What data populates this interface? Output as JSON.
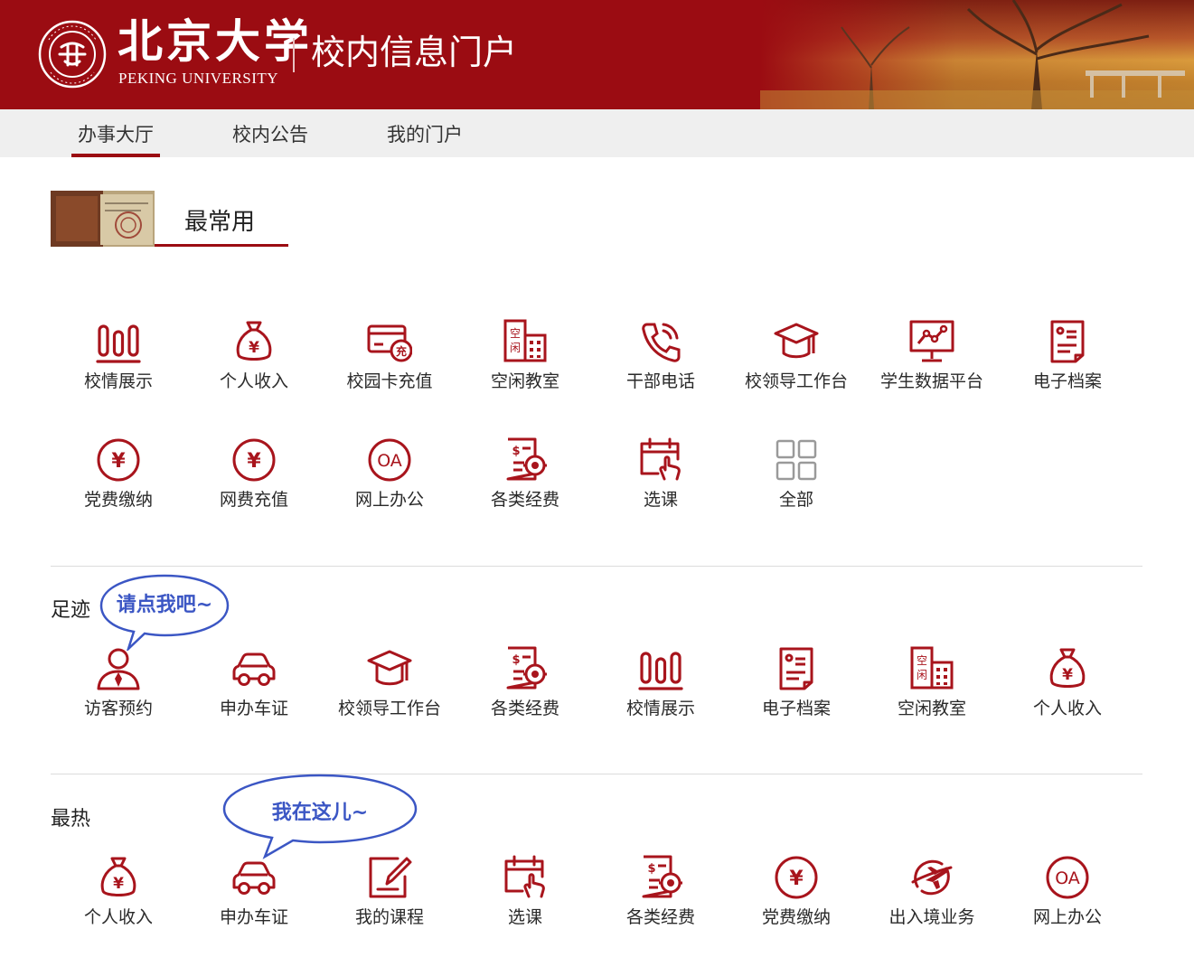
{
  "header": {
    "logo_cn": "北京大学",
    "logo_en": "PEKING UNIVERSITY",
    "portal_title": "校内信息门户",
    "brand_color": "#9b0c12"
  },
  "nav": {
    "tabs": [
      {
        "label": "办事大厅",
        "active": true
      },
      {
        "label": "校内公告",
        "active": false
      },
      {
        "label": "我的门户",
        "active": false
      }
    ]
  },
  "most_used": {
    "title": "最常用",
    "row1": [
      {
        "label": "校情展示",
        "icon": "bar-chart-icon"
      },
      {
        "label": "个人收入",
        "icon": "money-bag-icon"
      },
      {
        "label": "校园卡充值",
        "icon": "card-recharge-icon"
      },
      {
        "label": "空闲教室",
        "icon": "building-icon"
      },
      {
        "label": "干部电话",
        "icon": "phone-icon"
      },
      {
        "label": "校领导工作台",
        "icon": "graduation-cap-icon"
      },
      {
        "label": "学生数据平台",
        "icon": "monitor-chart-icon"
      },
      {
        "label": "电子档案",
        "icon": "document-icon"
      }
    ],
    "row2": [
      {
        "label": "党费缴纳",
        "icon": "yen-circle-icon"
      },
      {
        "label": "网费充值",
        "icon": "yen-circle-icon"
      },
      {
        "label": "网上办公",
        "icon": "oa-circle-icon"
      },
      {
        "label": "各类经费",
        "icon": "funds-document-icon"
      },
      {
        "label": "选课",
        "icon": "calendar-hand-icon"
      },
      {
        "label": "全部",
        "icon": "grid-icon"
      }
    ]
  },
  "footprints": {
    "title": "足迹",
    "bubble": "请点我吧~",
    "items": [
      {
        "label": "访客预约",
        "icon": "visitor-icon"
      },
      {
        "label": "申办车证",
        "icon": "car-icon"
      },
      {
        "label": "校领导工作台",
        "icon": "graduation-cap-icon"
      },
      {
        "label": "各类经费",
        "icon": "funds-document-icon"
      },
      {
        "label": "校情展示",
        "icon": "bar-chart-icon"
      },
      {
        "label": "电子档案",
        "icon": "document-icon"
      },
      {
        "label": "空闲教室",
        "icon": "building-icon"
      },
      {
        "label": "个人收入",
        "icon": "money-bag-icon"
      }
    ]
  },
  "hottest": {
    "title": "最热",
    "bubble": "我在这儿~",
    "items": [
      {
        "label": "个人收入",
        "icon": "money-bag-icon"
      },
      {
        "label": "申办车证",
        "icon": "car-icon"
      },
      {
        "label": "我的课程",
        "icon": "course-edit-icon"
      },
      {
        "label": "选课",
        "icon": "calendar-hand-icon"
      },
      {
        "label": "各类经费",
        "icon": "funds-document-icon"
      },
      {
        "label": "党费缴纳",
        "icon": "yen-circle-icon"
      },
      {
        "label": "出入境业务",
        "icon": "airplane-globe-icon"
      },
      {
        "label": "网上办公",
        "icon": "oa-circle-icon"
      }
    ]
  },
  "icon_badges": {
    "recharge": "充",
    "vacant_top": "空",
    "vacant_bottom": "闲",
    "yen": "¥",
    "oa": "OA",
    "dollar": "$"
  }
}
